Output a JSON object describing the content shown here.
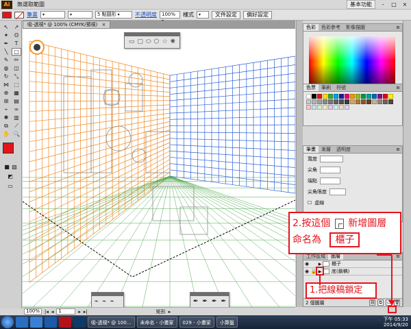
{
  "app": {
    "logo": "Ai"
  },
  "menubar": {
    "items": [
      "無選取範圍"
    ],
    "workspace": "基本功能",
    "window_controls": [
      "-",
      "□",
      "×"
    ]
  },
  "controlbar": {
    "stroke_label": "筆畫",
    "brush": "5 點圓形",
    "opacity_label": "不透明度",
    "opacity_value": "100%",
    "style_label": "樣式",
    "doc_setup": "文件設定",
    "prefs": "偏好設定"
  },
  "document": {
    "tab_title": "吸-透視* @ 100% (CMYK/預視)",
    "tab_close": "×",
    "zoom": "100%",
    "page": "1",
    "status_tool": "矩形"
  },
  "panels": {
    "color_tabs": [
      "色彩",
      "色彩參考",
      "影像描圖"
    ],
    "swatch_tabs": [
      "色票",
      "筆刷",
      "符號"
    ],
    "stroke_tabs": [
      "筆畫",
      "漸層",
      "透明度"
    ],
    "stroke_weight_label": "寬度",
    "stroke_rows": [
      "尖角",
      "端點",
      "尖角限度",
      "虛線"
    ],
    "layers_tabs": [
      "工作區域",
      "圖層"
    ],
    "layers": [
      {
        "name": "櫃子",
        "locked": false
      },
      {
        "name": "底(鎖稿)",
        "locked": true
      }
    ],
    "layers_count": "2 個圖層",
    "footer_icons": [
      "link-icon",
      "new-sublayer-icon",
      "new-layer-icon",
      "trash-icon"
    ]
  },
  "annotations": {
    "step2_text": "2.按這個",
    "step2_text2": "新增圖層",
    "step2_name_label": "命名為",
    "step2_name_value": "櫃子",
    "step1_text": "1.把線稿鎖定"
  },
  "taskbar": {
    "windows": [
      "吸-透視* @ 100...",
      "未命名 - 小畫家",
      "029 - 小畫家",
      "小算盤"
    ],
    "time": "下午 05:33",
    "date": "2014/9/20"
  },
  "colors": {
    "fill": "#e3141b",
    "accent": "#e5121b",
    "grid_left": "#f08a24",
    "grid_right": "#2a60d6",
    "grid_floor": "#4fa84f"
  }
}
